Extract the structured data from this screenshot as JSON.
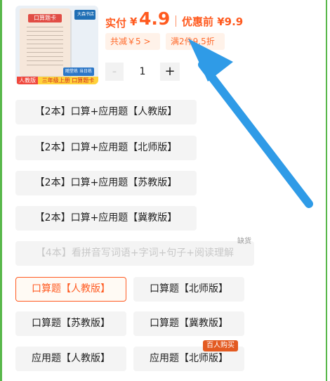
{
  "product": {
    "cover_title": "口算题卡",
    "brand_text": "大森书店",
    "cover_tag": "随堂练 当日练",
    "edition_badge": "人教版",
    "series_badge": "三年级上册 口算题卡",
    "price_label": "实付",
    "currency": "¥",
    "price": "4.9",
    "price_before_label": "优惠前 ¥9.9",
    "promo_discount": "共减￥5 >",
    "promo_deal": "满2件9.5折"
  },
  "quantity": {
    "minus": "-",
    "value": "1",
    "plus": "+"
  },
  "skus": [
    "【2本】口算+应用题【人教版】",
    "【2本】口算+应用题【北师版】",
    "【2本】口算+应用题【苏教版】",
    "【2本】口算+应用题【冀教版】",
    "【4本】看拼音写词语+字词+句子+阅读理解",
    "口算题【人教版】",
    "口算题【北师版】",
    "口算题【苏教版】",
    "口算题【冀教版】",
    "应用题【人教版】",
    "应用题【北师版】"
  ],
  "tags": {
    "out_of_stock": "缺货",
    "hot": "百人购买"
  },
  "colors": {
    "accent": "#ff5a1f",
    "frame_green": "#59b84b",
    "arrow_blue": "#2f9be7"
  }
}
